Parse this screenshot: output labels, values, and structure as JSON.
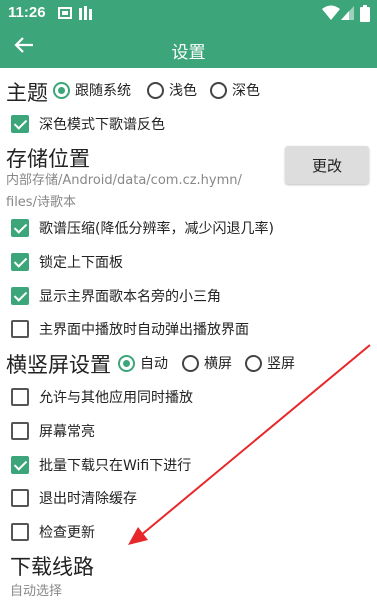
{
  "status_bar": {
    "time": "11:26"
  },
  "toolbar": {
    "back_icon": "arrow-left-icon",
    "title": "设置"
  },
  "theme": {
    "heading": "主题",
    "options": [
      {
        "label": "跟随系统",
        "selected": true
      },
      {
        "label": "浅色",
        "selected": false
      },
      {
        "label": "深色",
        "selected": false
      }
    ]
  },
  "dark_invert": {
    "label": "深色模式下歌谱反色",
    "checked": true
  },
  "storage": {
    "heading": "存储位置",
    "path_line1": "内部存储/Android/data/com.cz.hymn/",
    "path_line2": "files/诗歌本",
    "change_label": "更改"
  },
  "options_a": [
    {
      "label": "歌谱压缩(降低分辨率，减少闪退几率)",
      "checked": true
    },
    {
      "label": "锁定上下面板",
      "checked": true
    },
    {
      "label": "显示主界面歌本名旁的小三角",
      "checked": true
    },
    {
      "label": "主界面中播放时自动弹出播放界面",
      "checked": false
    }
  ],
  "orientation": {
    "heading": "横竖屏设置",
    "options": [
      {
        "label": "自动",
        "selected": true
      },
      {
        "label": "横屏",
        "selected": false
      },
      {
        "label": "竖屏",
        "selected": false
      }
    ]
  },
  "options_b": [
    {
      "label": "允许与其他应用同时播放",
      "checked": false
    },
    {
      "label": "屏幕常亮",
      "checked": false
    },
    {
      "label": "批量下载只在Wifi下进行",
      "checked": true
    },
    {
      "label": "退出时清除缓存",
      "checked": false
    },
    {
      "label": "检查更新",
      "checked": false
    }
  ],
  "download": {
    "heading": "下载线路",
    "value": "自动选择"
  },
  "colors": {
    "accent": "#3ca57a",
    "annotation": "#e8272a"
  }
}
